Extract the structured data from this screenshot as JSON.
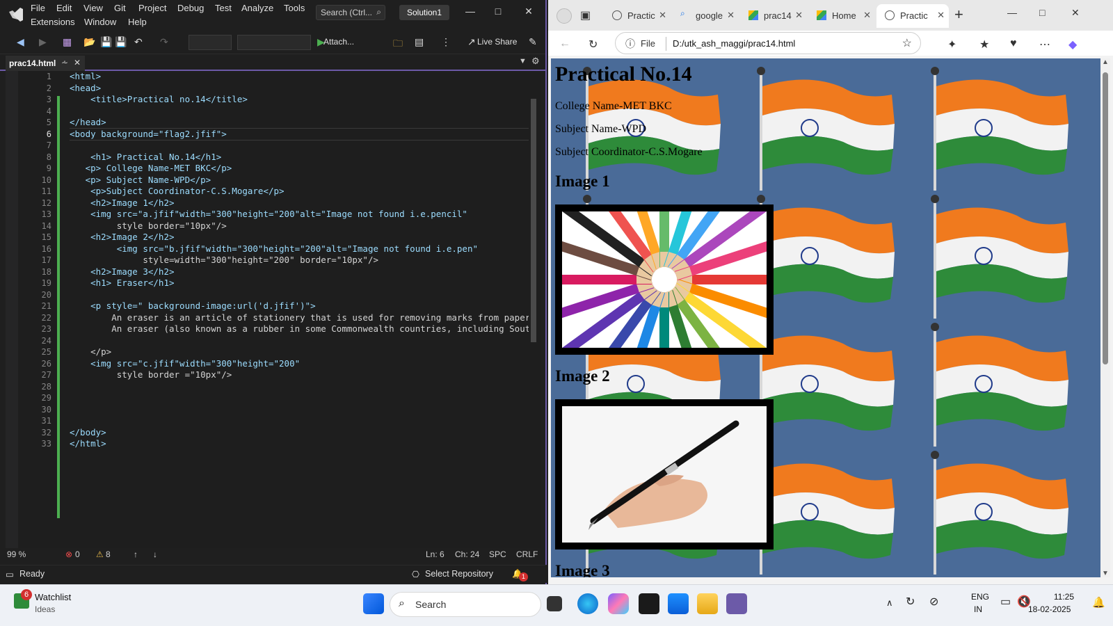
{
  "vs": {
    "menu": [
      "File",
      "Edit",
      "View",
      "Git",
      "Project",
      "Debug",
      "Test",
      "Analyze",
      "Tools",
      "Extensions",
      "Window",
      "Help"
    ],
    "search": "Search (Ctrl...",
    "solution": "Solution1",
    "toolbar": {
      "attach": "Attach...",
      "live_share": "Live Share"
    },
    "tab": {
      "filename": "prac14.html"
    },
    "line_numbers": [
      "1",
      "2",
      "3",
      "4",
      "5",
      "6",
      "7",
      "8",
      "9",
      "10",
      "11",
      "12",
      "13",
      "14",
      "15",
      "16",
      "17",
      "18",
      "19",
      "20",
      "21",
      "22",
      "23",
      "24",
      "25",
      "26",
      "27",
      "28",
      "29",
      "30",
      "31",
      "32",
      "33"
    ],
    "code_lines": [
      "<html>",
      "<head>",
      "    <title>Practical no.14</title>",
      "",
      "</head>",
      "<body background=\"flag2.jfif\">",
      "",
      "    <h1> Practical No.14</h1>",
      "   <p> College Name-MET BKC</p>",
      "   <p> Subject Name-WPD</p>",
      "    <p>Subject Coordinator-C.S.Mogare</p>",
      "    <h2>Image 1</h2>",
      "    <img src=\"a.jfif\"width=\"300\"height=\"200\"alt=\"Image not found i.e.pencil\"",
      "         style border=\"10px\"/>",
      "    <h2>Image 2</h2>",
      "         <img src=\"b.jfif\"width=\"300\"height=\"200\"alt=\"Image not found i.e.pen\"",
      "              style=width=\"300\"height=\"200\" border=\"10px\"/>",
      "    <h2>Image 3</h2>",
      "    <h1> Eraser</h1>",
      "",
      "    <p style=\" background-image:url('d.jfif')\">",
      "        An eraser is an article of stationery that is used for removing marks from paper",
      "        An eraser (also known as a rubber in some Commonwealth countries, including South",
      "",
      "    </p>",
      "    <img src=\"c.jfif\"width=\"300\"height=\"200\"",
      "         style border =\"10px\"/>",
      "",
      "",
      "",
      "",
      "</body>",
      "</html>"
    ],
    "status": {
      "zoom": "99 %",
      "errors": "0",
      "warnings": "8",
      "ln": "Ln: 6",
      "ch": "Ch: 24",
      "spc": "SPC",
      "crlf": "CRLF",
      "ready": "Ready",
      "select_repo": "Select Repository",
      "notif_count": "1"
    }
  },
  "edge": {
    "tabs": [
      {
        "label": "Practic",
        "icon": "globe-icon"
      },
      {
        "label": "google",
        "icon": "search-icon"
      },
      {
        "label": "prac14",
        "icon": "drive-icon"
      },
      {
        "label": "Home",
        "icon": "drive-icon"
      },
      {
        "label": "Practic",
        "icon": "globe-icon"
      }
    ],
    "address": {
      "scheme": "File",
      "url": "D:/utk_ash_maggi/prac14.html"
    },
    "page": {
      "h1": "Practical No.14",
      "p1": "College Name-MET BKC",
      "p2": "Subject Name-WPD",
      "p3": "Subject Coordinator-C.S.Mogare",
      "h2_1": "Image 1",
      "h2_2": "Image 2",
      "h2_3": "Image 3"
    }
  },
  "taskbar": {
    "watchlist_title": "Watchlist",
    "watchlist_sub": "Ideas",
    "watchlist_badge": "6",
    "search": "Search",
    "lang1": "ENG",
    "lang2": "IN",
    "time": "11:25",
    "date": "18-02-2025"
  },
  "colors": {
    "vs_accent": "#6c5aa8",
    "page_bg": "#4a6b98",
    "saffron": "#f07a1e",
    "green": "#2e8b3a"
  }
}
